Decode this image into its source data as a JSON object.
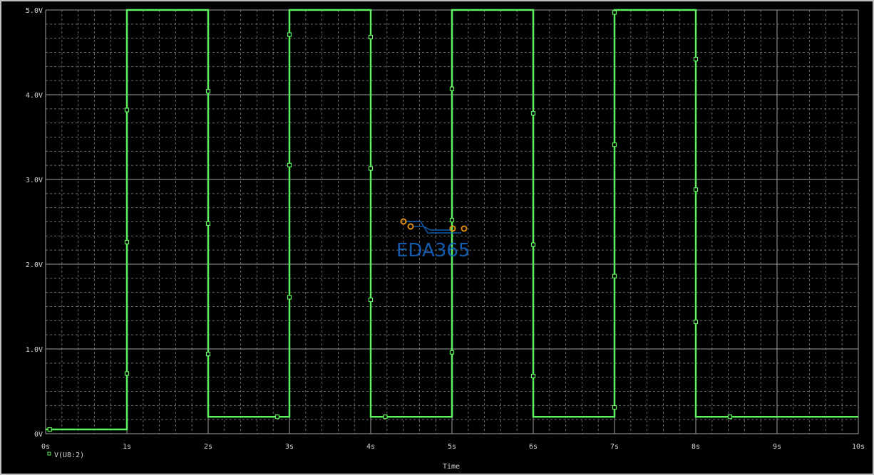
{
  "chart_data": {
    "type": "line",
    "xlabel": "Time",
    "ylabel": "",
    "xlim": [
      0,
      10
    ],
    "ylim": [
      0,
      5
    ],
    "x_ticks": [
      "0s",
      "1s",
      "2s",
      "3s",
      "4s",
      "5s",
      "6s",
      "7s",
      "8s",
      "9s",
      "10s"
    ],
    "y_ticks": [
      "0V",
      "1.0V",
      "2.0V",
      "3.0V",
      "4.0V",
      "5.0V"
    ],
    "grid": true,
    "legend_position": "bottom-left",
    "series": [
      {
        "name": "V(U8:2)",
        "color": "#5ef05e",
        "x": [
          0,
          1.0,
          1.0,
          2.0,
          2.0,
          3.0,
          3.0,
          4.0,
          4.0,
          5.0,
          5.0,
          6.0,
          6.0,
          7.0,
          7.0,
          8.0,
          8.0,
          10.0
        ],
        "y": [
          0.05,
          0.05,
          5.0,
          5.0,
          0.2,
          0.2,
          5.0,
          5.0,
          0.2,
          0.2,
          5.0,
          5.0,
          0.2,
          0.2,
          5.0,
          5.0,
          0.2,
          0.2
        ],
        "markers": [
          [
            0.05,
            0.05
          ],
          [
            1.0,
            3.82
          ],
          [
            1.0,
            2.26
          ],
          [
            1.0,
            0.71
          ],
          [
            2.0,
            4.04
          ],
          [
            2.0,
            2.48
          ],
          [
            2.0,
            0.94
          ],
          [
            2.85,
            0.2
          ],
          [
            3.0,
            4.71
          ],
          [
            3.0,
            3.17
          ],
          [
            3.0,
            1.61
          ],
          [
            4.0,
            4.68
          ],
          [
            4.0,
            3.13
          ],
          [
            4.0,
            1.58
          ],
          [
            4.18,
            0.2
          ],
          [
            5.0,
            4.07
          ],
          [
            5.0,
            2.52
          ],
          [
            5.0,
            0.96
          ],
          [
            6.0,
            3.78
          ],
          [
            6.0,
            2.23
          ],
          [
            6.0,
            0.68
          ],
          [
            7.0,
            4.97
          ],
          [
            7.0,
            3.41
          ],
          [
            7.0,
            1.86
          ],
          [
            7.0,
            0.31
          ],
          [
            8.0,
            4.42
          ],
          [
            8.0,
            2.88
          ],
          [
            8.0,
            1.32
          ],
          [
            8.42,
            0.2
          ]
        ]
      }
    ]
  },
  "watermark": {
    "text": "EDA365",
    "text_color": "#1565c0",
    "dot_color": "#f39c12"
  },
  "colors": {
    "background": "#000000",
    "grid_major": "#a0a0a0",
    "grid_minor": "#6a6a6a",
    "axis_text": "#d8d8d8"
  }
}
